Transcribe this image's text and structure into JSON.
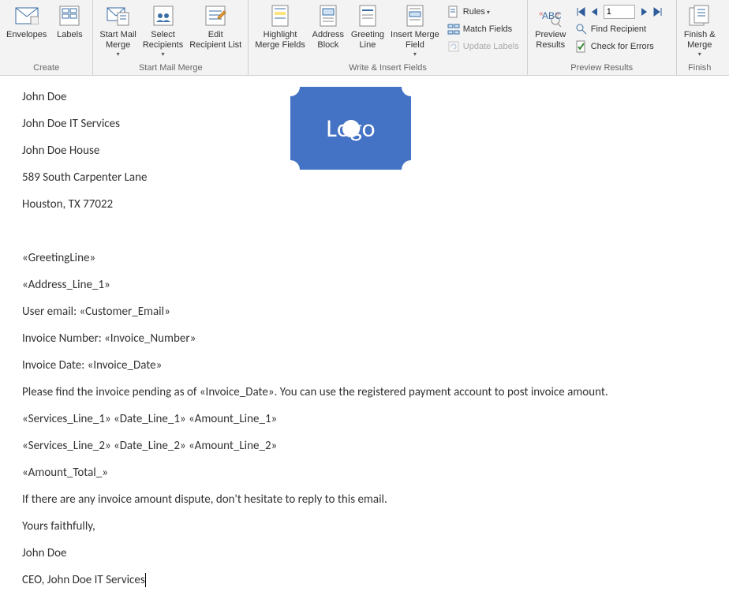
{
  "ribbon": {
    "create": {
      "label": "Create",
      "envelopes": "Envelopes",
      "labels": "Labels"
    },
    "start_mail_merge": {
      "label": "Start Mail Merge",
      "start": "Start Mail\nMerge",
      "select": "Select\nRecipients",
      "edit": "Edit\nRecipient List"
    },
    "write_insert": {
      "label": "Write & Insert Fields",
      "highlight": "Highlight\nMerge Fields",
      "address": "Address\nBlock",
      "greeting": "Greeting\nLine",
      "insert": "Insert Merge\nField",
      "rules": "Rules",
      "match": "Match Fields",
      "update": "Update Labels"
    },
    "preview": {
      "label": "Preview Results",
      "preview": "Preview\nResults",
      "record": "1",
      "find": "Find Recipient",
      "check": "Check for Errors"
    },
    "finish": {
      "label": "Finish",
      "finish": "Finish &\nMerge"
    }
  },
  "document": {
    "logo": "Logo",
    "lines": [
      "John Doe",
      "John Doe IT Services",
      "John Doe House",
      "589 South Carpenter Lane",
      "Houston, TX 77022",
      "",
      "«GreetingLine»",
      "«Address_Line_1»",
      "User email: «Customer_Email»",
      "Invoice Number: «Invoice_Number»",
      "Invoice Date: «Invoice_Date»",
      "Please find the invoice pending as of «Invoice_Date». You can use the registered payment account to post invoice amount.",
      "«Services_Line_1» «Date_Line_1» «Amount_Line_1»",
      "«Services_Line_2» «Date_Line_2» «Amount_Line_2»",
      "«Amount_Total_»",
      "If there are any invoice amount dispute, don't hesitate to reply to this email.",
      "Yours faithfully,",
      "John Doe",
      "CEO, John Doe IT Services"
    ]
  }
}
